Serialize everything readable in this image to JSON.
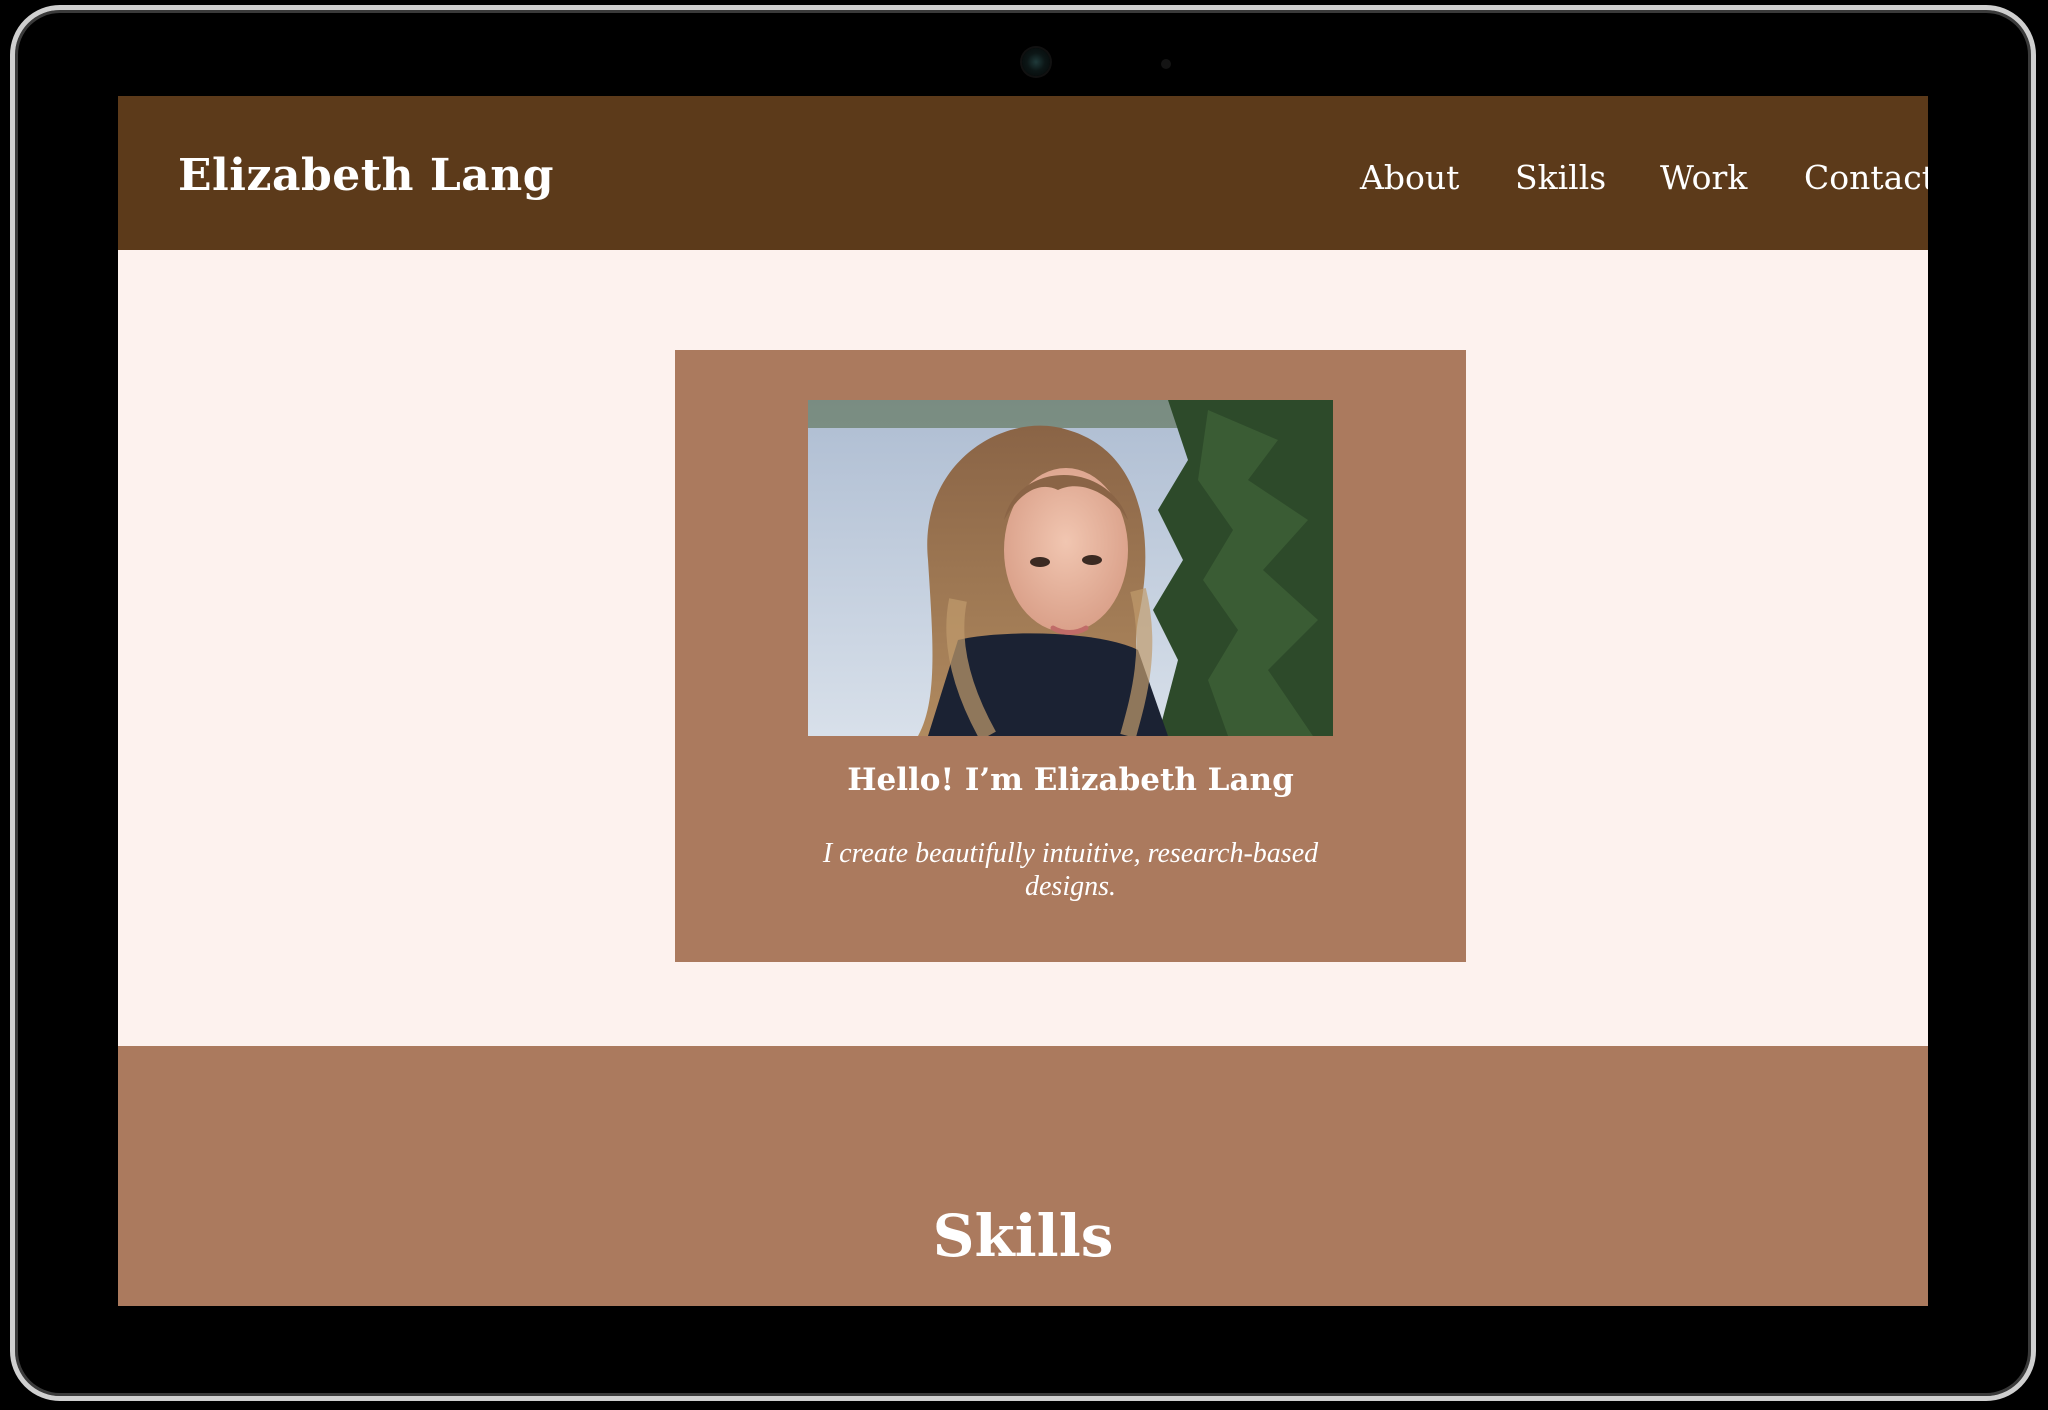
{
  "site": {
    "logo": "Elizabeth Lang"
  },
  "nav": {
    "items": [
      {
        "label": "About"
      },
      {
        "label": "Skills"
      },
      {
        "label": "Work"
      },
      {
        "label": "Contact"
      }
    ]
  },
  "hero": {
    "title": "Hello! I’m Elizabeth Lang",
    "tagline": "I create beautifully intuitive, research-based designs."
  },
  "skills": {
    "title": "Skills"
  },
  "colors": {
    "header_bg": "#5c3a1a",
    "page_bg": "#fdf2ee",
    "card_bg": "#ab7a5e",
    "text": "#ffffff"
  }
}
